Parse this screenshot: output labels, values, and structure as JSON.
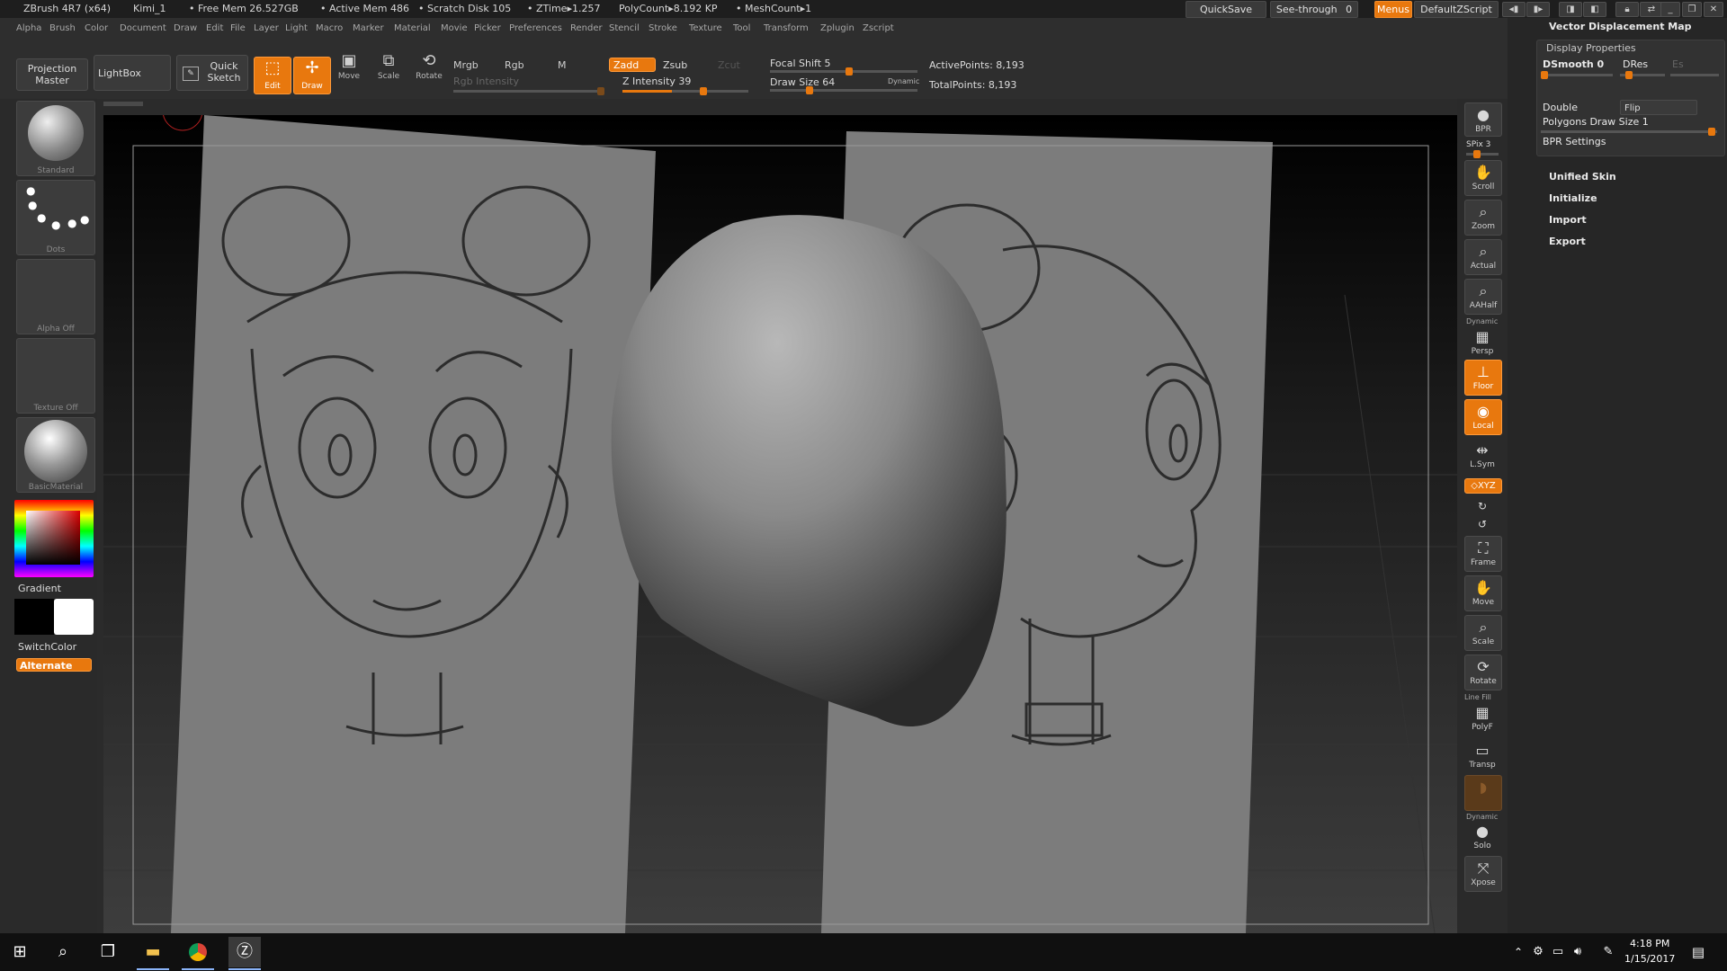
{
  "titlebar": {
    "app": "ZBrush 4R7 (x64)",
    "doc": "Kimi_1",
    "free_mem": "• Free Mem 26.527GB",
    "active_mem": "• Active Mem 486",
    "scratch": "• Scratch Disk 105",
    "ztime": "• ZTime▸1.257",
    "polycount": "PolyCount▸8.192 KP",
    "meshcount": "• MeshCount▸1",
    "quicksave": "QuickSave",
    "seethrough": "See-through",
    "seethrough_val": "0",
    "menus": "Menus",
    "script": "DefaultZScript"
  },
  "menubar": [
    "Alpha",
    "Brush",
    "Color",
    "Document",
    "Draw",
    "Edit",
    "File",
    "Layer",
    "Light",
    "Macro",
    "Marker",
    "Material",
    "Movie",
    "Picker",
    "Preferences",
    "Render",
    "Stencil",
    "Stroke",
    "Texture",
    "Tool",
    "Transform",
    "Zplugin",
    "Zscript"
  ],
  "shelf": {
    "projection_master": "Projection Master",
    "lightbox": "LightBox",
    "quick_sketch": "Quick Sketch",
    "edit": "Edit",
    "draw": "Draw",
    "move": "Move",
    "scale": "Scale",
    "rotate": "Rotate",
    "mrgb": "Mrgb",
    "rgb": "Rgb",
    "m": "M",
    "rgb_intensity": "Rgb Intensity",
    "zadd": "Zadd",
    "zsub": "Zsub",
    "zcut": "Zcut",
    "z_intensity": "Z Intensity 39",
    "z_intensity_value": 39,
    "focal_shift": "Focal Shift 5",
    "focal_shift_value": 5,
    "draw_size": "Draw Size 64",
    "draw_size_value": 64,
    "dynamic": "Dynamic",
    "active_points": "ActivePoints: 8,193",
    "total_points": "TotalPoints: 8,193"
  },
  "leftpanel": {
    "brush": "Standard",
    "stroke": "Dots",
    "alpha": "Alpha Off",
    "texture": "Texture Off",
    "material": "BasicMaterial",
    "gradient": "Gradient",
    "switchcolor": "SwitchColor",
    "alternate": "Alternate"
  },
  "rightstrip": {
    "bpr": "BPR",
    "spix": "SPix 3",
    "scroll": "Scroll",
    "zoom": "Zoom",
    "actual": "Actual",
    "aahalf": "AAHalf",
    "dynamic": "Dynamic",
    "persp": "Persp",
    "floor": "Floor",
    "local": "Local",
    "lsym": "L.Sym",
    "xyz": "◇XYZ",
    "frame": "Frame",
    "move": "Move",
    "scale": "Scale",
    "rotate": "Rotate",
    "linefill": "Line Fill",
    "polyf": "PolyF",
    "transp": "Transp",
    "dynamic2": "Dynamic",
    "solo": "Solo",
    "xpose": "Xpose"
  },
  "rightpanel": {
    "vdm": "Vector Displacement Map",
    "display_properties": "Display Properties",
    "dsmooth": "DSmooth 0",
    "dres": "DRes",
    "es": "Es",
    "double": "Double",
    "flip": "Flip",
    "polygons_draw_size": "Polygons Draw Size 1",
    "bpr_settings": "BPR Settings",
    "unified_skin": "Unified Skin",
    "initialize": "Initialize",
    "import": "Import",
    "export": "Export"
  },
  "taskbar": {
    "time": "4:18 PM",
    "date": "1/15/2017"
  },
  "colors": {
    "accent": "#e8780e",
    "bg": "#2b2b2b"
  }
}
